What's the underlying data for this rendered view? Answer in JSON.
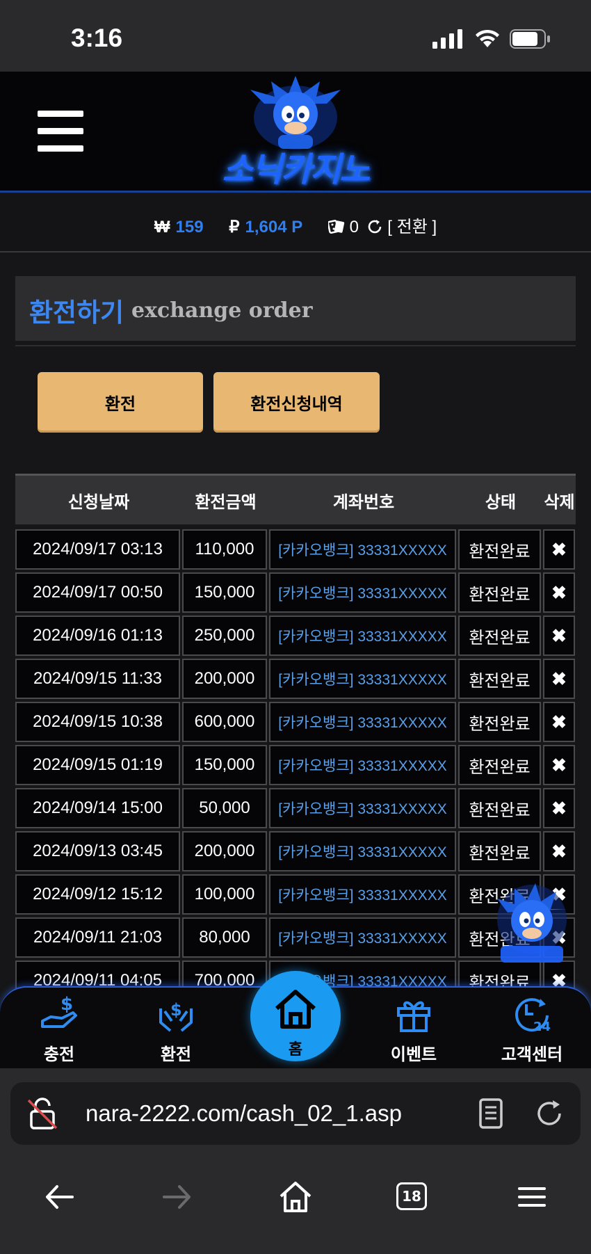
{
  "status_bar": {
    "time": "3:16"
  },
  "header": {
    "logo_text": "소닉카지노"
  },
  "balance": {
    "won_symbol": "₩",
    "won_value": "159",
    "point_symbol": "₽",
    "point_value": "1,604 P",
    "chip_value": "0",
    "switch_label": "[ 전환 ]"
  },
  "page": {
    "title_kr": "환전하기",
    "title_en": "exchange order"
  },
  "buttons": {
    "exchange": "환전",
    "history": "환전신청내역"
  },
  "table": {
    "headers": [
      "신청날짜",
      "환전금액",
      "계좌번호",
      "상태",
      "삭제"
    ],
    "rows": [
      {
        "date": "2024/09/17 03:13",
        "amount": "110,000",
        "account": "[카카오뱅크] 33331XXXXX",
        "status": "환전완료",
        "delete": "✖"
      },
      {
        "date": "2024/09/17 00:50",
        "amount": "150,000",
        "account": "[카카오뱅크] 33331XXXXX",
        "status": "환전완료",
        "delete": "✖"
      },
      {
        "date": "2024/09/16 01:13",
        "amount": "250,000",
        "account": "[카카오뱅크] 33331XXXXX",
        "status": "환전완료",
        "delete": "✖"
      },
      {
        "date": "2024/09/15 11:33",
        "amount": "200,000",
        "account": "[카카오뱅크] 33331XXXXX",
        "status": "환전완료",
        "delete": "✖"
      },
      {
        "date": "2024/09/15 10:38",
        "amount": "600,000",
        "account": "[카카오뱅크] 33331XXXXX",
        "status": "환전완료",
        "delete": "✖"
      },
      {
        "date": "2024/09/15 01:19",
        "amount": "150,000",
        "account": "[카카오뱅크] 33331XXXXX",
        "status": "환전완료",
        "delete": "✖"
      },
      {
        "date": "2024/09/14 15:00",
        "amount": "50,000",
        "account": "[카카오뱅크] 33331XXXXX",
        "status": "환전완료",
        "delete": "✖"
      },
      {
        "date": "2024/09/13 03:45",
        "amount": "200,000",
        "account": "[카카오뱅크] 33331XXXXX",
        "status": "환전완료",
        "delete": "✖"
      },
      {
        "date": "2024/09/12 15:12",
        "amount": "100,000",
        "account": "[카카오뱅크] 33331XXXXX",
        "status": "환전완료",
        "delete": "✖"
      },
      {
        "date": "2024/09/11 21:03",
        "amount": "80,000",
        "account": "[카카오뱅크] 33331XXXXX",
        "status": "환전완료",
        "delete": "✖"
      },
      {
        "date": "2024/09/11 04:05",
        "amount": "700,000",
        "account": "[카카오뱅크] 33331XXXXX",
        "status": "환전완료",
        "delete": "✖"
      }
    ]
  },
  "bottom_nav": {
    "charge": "충전",
    "exchange": "환전",
    "home": "홈",
    "event": "이벤트",
    "support": "고객센터"
  },
  "browser": {
    "url": "nara-2222.com/cash_02_1.asp",
    "tab_count": "18"
  },
  "colors": {
    "accent_blue": "#2f7ff0",
    "button_gold": "#e8b872",
    "home_blue": "#1a9af0"
  }
}
